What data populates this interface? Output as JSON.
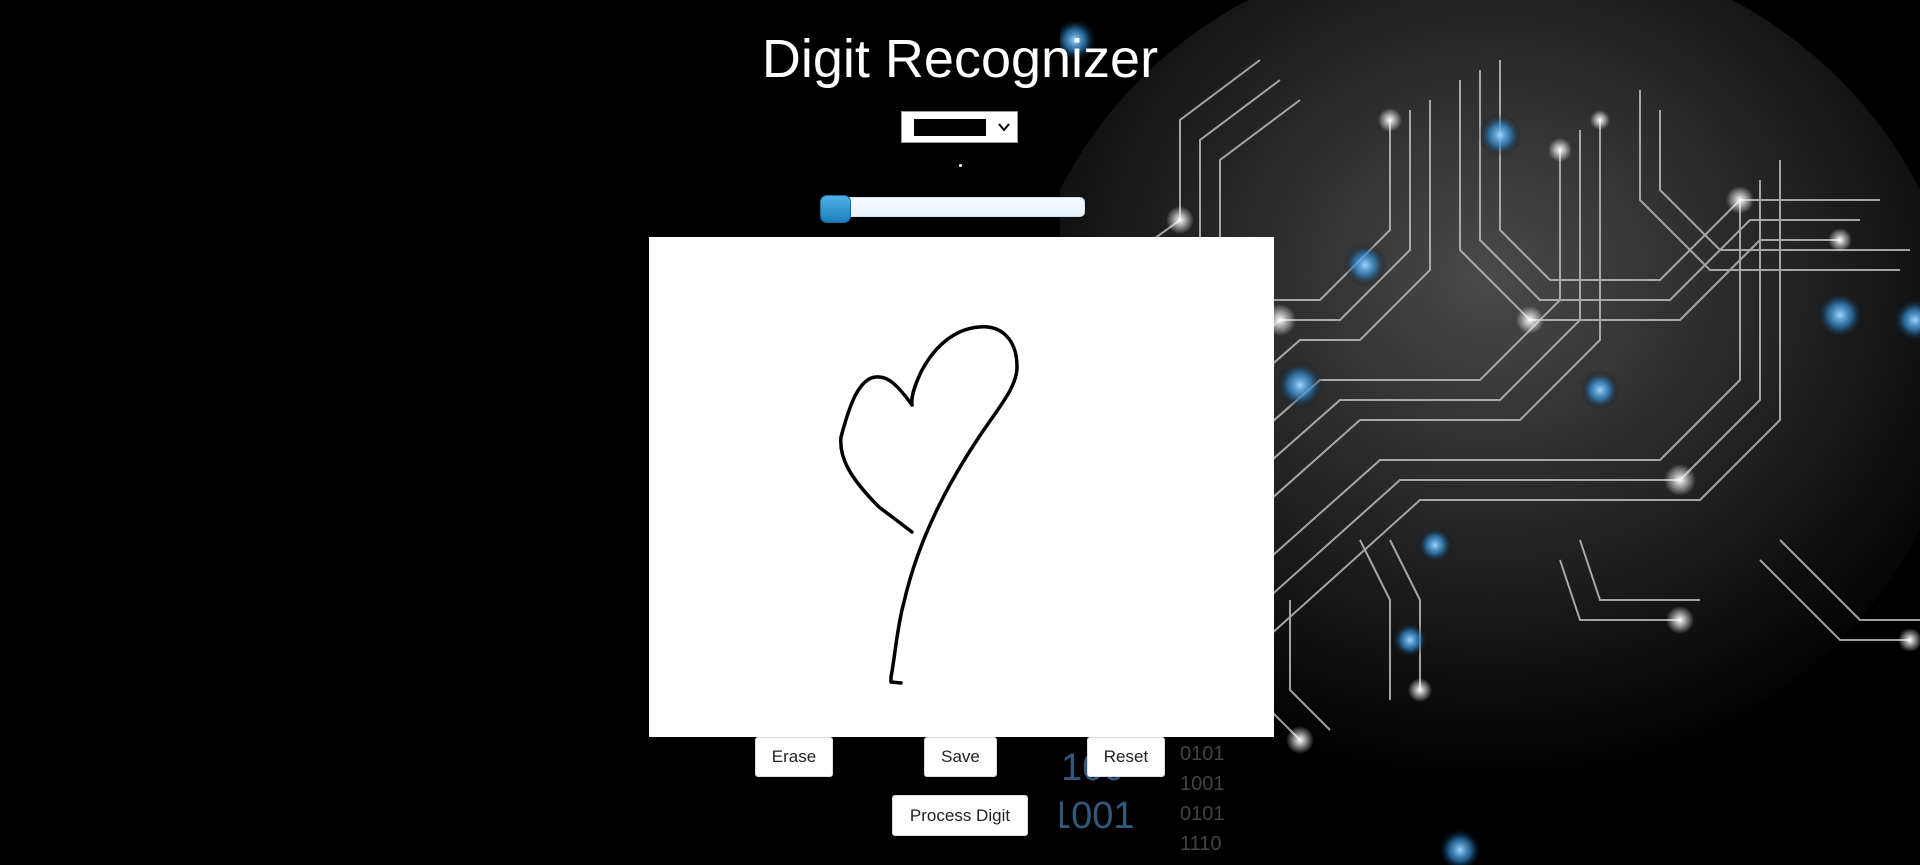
{
  "app": {
    "title": "Digit Recognizer"
  },
  "color_select": {
    "selected_color": "#000000",
    "icon": "chevron-down-icon"
  },
  "brush_size_slider": {
    "value": 0
  },
  "buttons": {
    "erase_label": "Erase",
    "save_label": "Save",
    "reset_label": "Reset",
    "process_label": "Process Digit"
  },
  "colors": {
    "background": "#000000",
    "slider_thumb": "#1a7fbc",
    "canvas": "#ffffff"
  }
}
